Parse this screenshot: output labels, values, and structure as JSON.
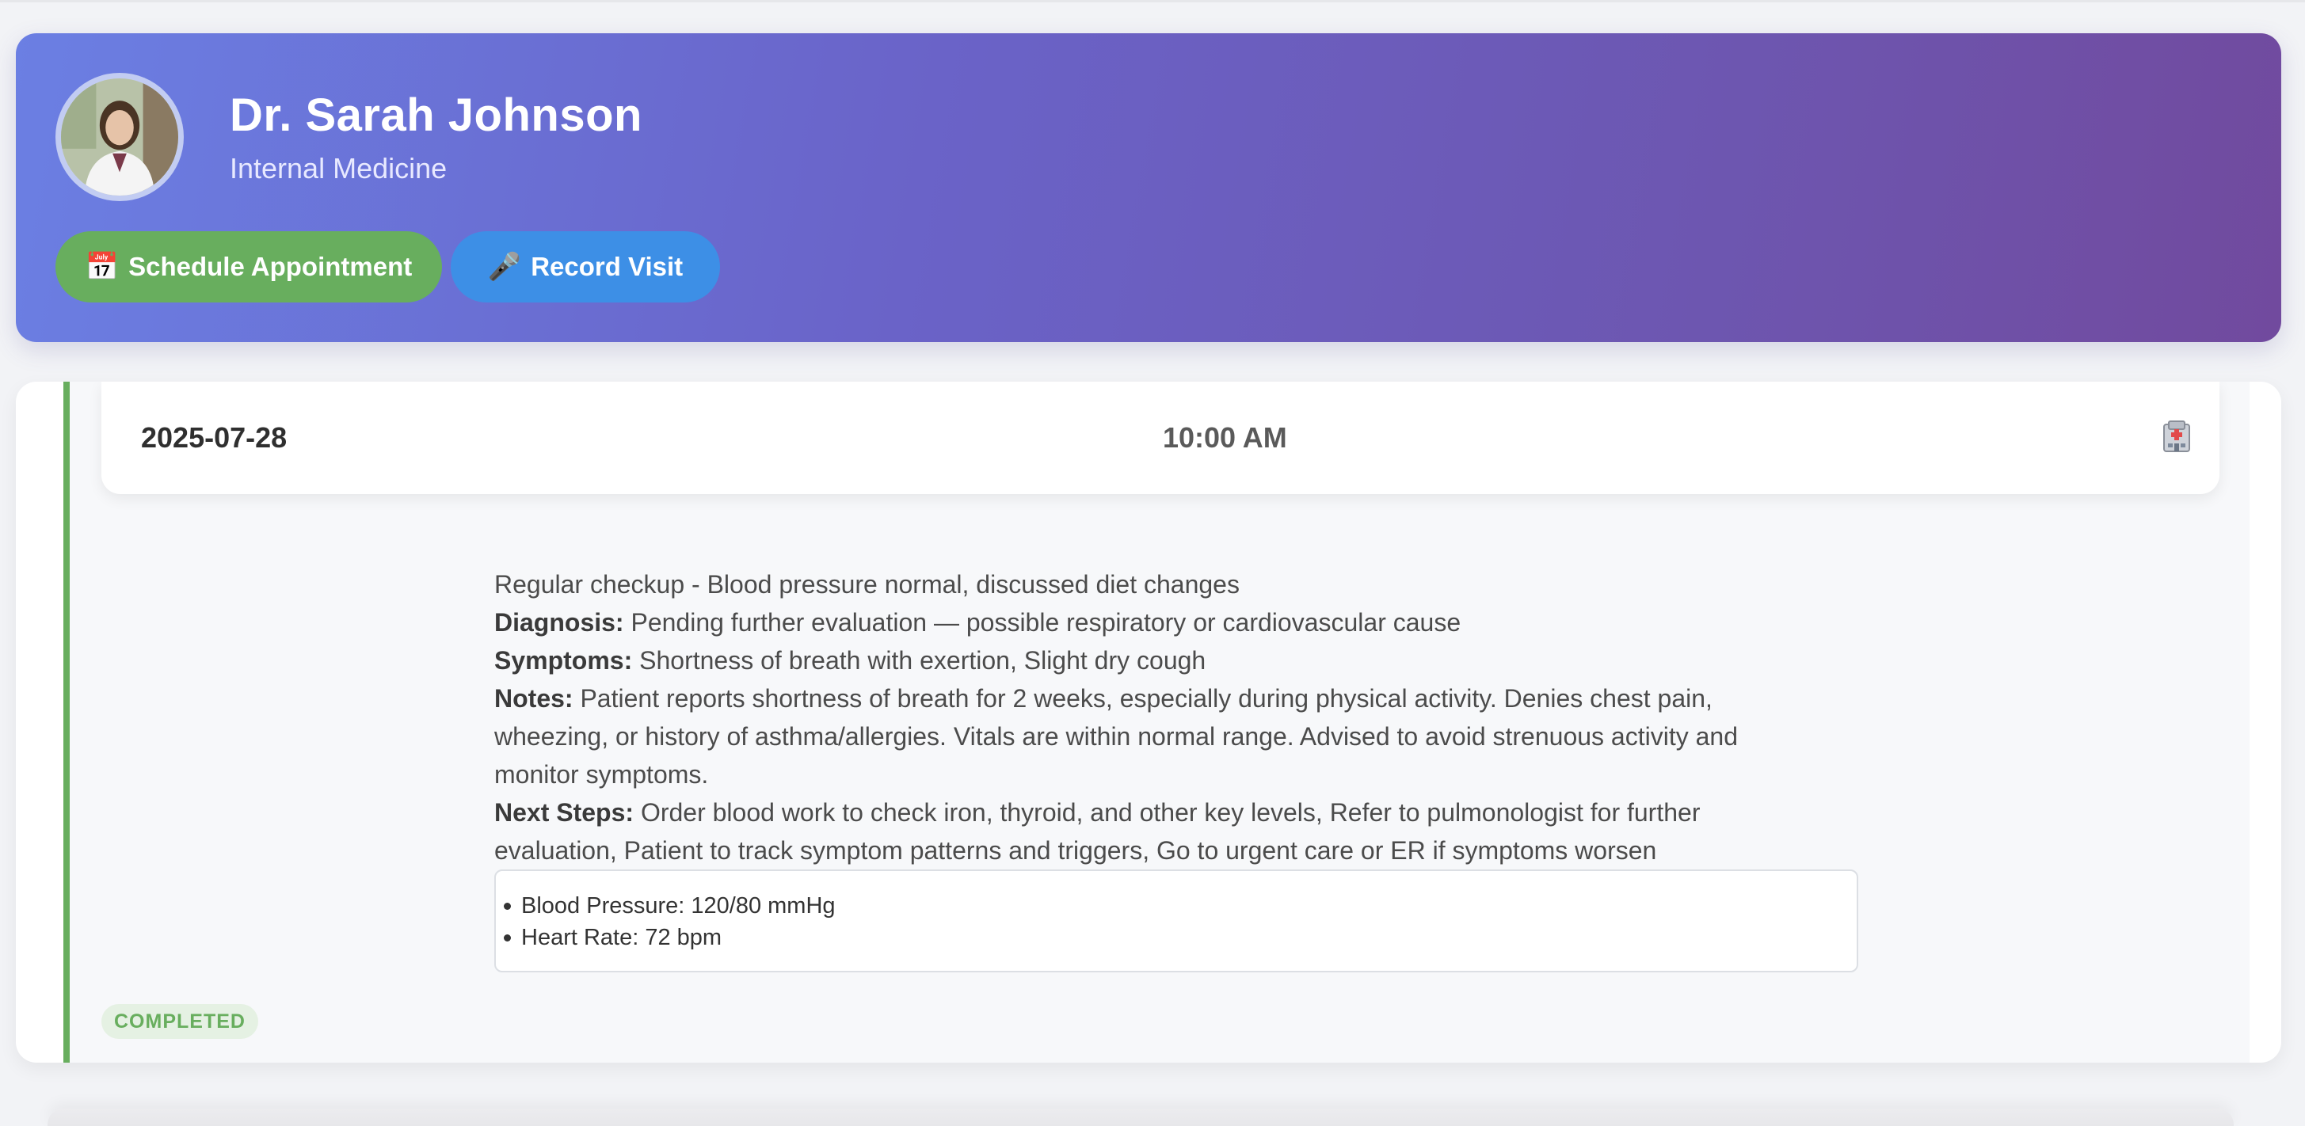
{
  "doctor": {
    "name": "Dr. Sarah Johnson",
    "specialty": "Internal Medicine"
  },
  "actions": {
    "schedule_label": "Schedule Appointment",
    "schedule_icon": "📅",
    "record_label": "Record Visit",
    "record_icon": "🎤"
  },
  "visit": {
    "date": "2025-07-28",
    "time": "10:00 AM",
    "location_icon": "hospital-icon",
    "summary": "Regular checkup - Blood pressure normal, discussed diet changes",
    "diagnosis_label": "Diagnosis:",
    "diagnosis": "Pending further evaluation — possible respiratory or cardiovascular cause",
    "symptoms_label": "Symptoms:",
    "symptoms": "Shortness of breath with exertion, Slight dry cough",
    "notes_label": "Notes:",
    "notes": "Patient reports shortness of breath for 2 weeks, especially during physical activity. Denies chest pain, wheezing, or history of asthma/allergies. Vitals are within normal range. Advised to avoid strenuous activity and monitor symptoms.",
    "next_steps_label": "Next Steps:",
    "next_steps": "Order blood work to check iron, thyroid, and other key levels, Refer to pulmonologist for further evaluation, Patient to track symptom patterns and triggers, Go to urgent care or ER if symptoms worsen",
    "vitals": [
      "Blood Pressure: 120/80 mmHg",
      "Heart Rate: 72 bpm"
    ],
    "status": "COMPLETED"
  },
  "colors": {
    "header_gradient_start": "#6b7fe3",
    "header_gradient_end": "#714a9e",
    "schedule_button": "#68ae5e",
    "record_button": "#3d8fe6",
    "status_completed": "#68ae5e"
  }
}
